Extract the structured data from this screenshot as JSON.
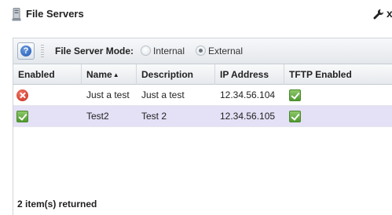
{
  "window": {
    "title": "File Servers",
    "title_icon": "server-icon",
    "settings_icon": "wrench-icon",
    "close_glyph": "x"
  },
  "toolbar": {
    "help_glyph": "?",
    "mode_label": "File Server Mode:",
    "options": [
      {
        "label": "Internal",
        "selected": false
      },
      {
        "label": "External",
        "selected": true
      }
    ]
  },
  "grid": {
    "columns": [
      {
        "label": "Enabled"
      },
      {
        "label": "Name",
        "sorted": "ascending",
        "sort_glyph": "▲"
      },
      {
        "label": "Description"
      },
      {
        "label": "IP Address"
      },
      {
        "label": "TFTP Enabled"
      }
    ],
    "rows": [
      {
        "enabled": false,
        "name": "Just a test",
        "description": "Just a test",
        "ip": "12.34.56.104",
        "tftp_enabled": true,
        "selected": false
      },
      {
        "enabled": true,
        "name": "Test2",
        "description": "Test 2",
        "ip": "12.34.56.105",
        "tftp_enabled": true,
        "selected": true
      }
    ]
  },
  "footer": {
    "count_text": "2 item(s) returned"
  },
  "colors": {
    "selected_row": "#e4e0f6",
    "check_green": "#5ea63a",
    "error_red": "#d63a2a",
    "help_blue": "#2a62c0"
  }
}
